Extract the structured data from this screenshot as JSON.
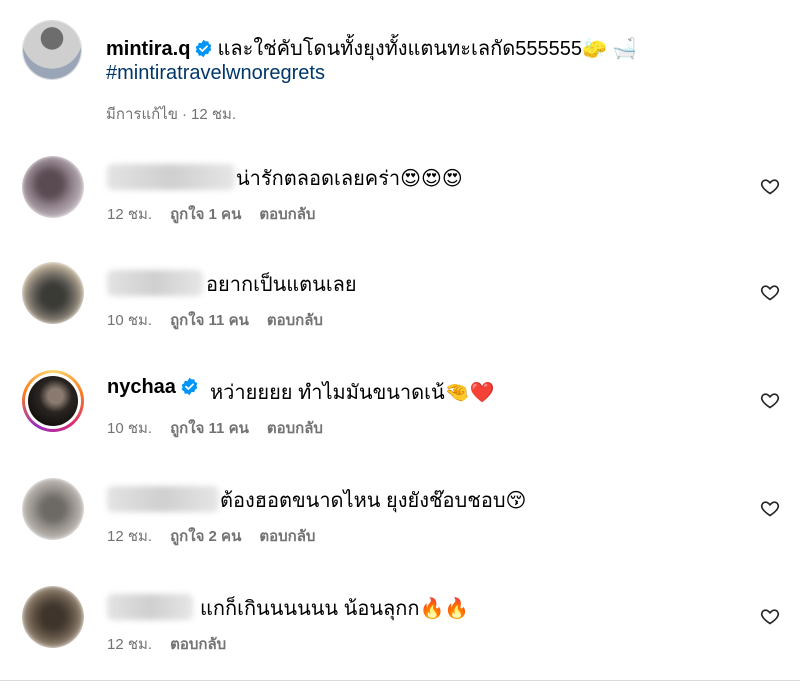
{
  "post": {
    "username": "mintira.q",
    "caption": "และใช่คับโดนทั้งยุงทั้งแตนทะเลกัด555555",
    "caption_emojis": "🧽 🛁",
    "hashtag": "#mintiratravelwnoregrets",
    "edited_label": "มีการแก้ไข",
    "separator": "·",
    "time": "12 ชม."
  },
  "comments": [
    {
      "text": "น่ารักตลอดเลยคร่า😍😍😍",
      "time": "12 ชม.",
      "likes": "ถูกใจ 1 คน",
      "reply": "ตอบกลับ"
    },
    {
      "text": "อยากเป็นแตนเลย",
      "time": "10 ชม.",
      "likes": "ถูกใจ 11 คน",
      "reply": "ตอบกลับ"
    },
    {
      "username": "nychaa",
      "text": "หว่ายยยย ทำไมมันขนาดเน้🤏❤️",
      "time": "10 ชม.",
      "likes": "ถูกใจ 11 คน",
      "reply": "ตอบกลับ"
    },
    {
      "text": "ต้องฮอตขนาดไหน ยุงยังช๊อบชอบ😚",
      "time": "12 ชม.",
      "likes": "ถูกใจ 2 คน",
      "reply": "ตอบกลับ"
    },
    {
      "text": "แกก็เกินนนนนน น้อนลุกก🔥🔥",
      "time": "12 ชม.",
      "reply": "ตอบกลับ"
    }
  ],
  "colors": {
    "verified": "#0095f6",
    "hashtag": "#00376b",
    "meta": "#737373",
    "story_ring_start": "#feda75",
    "story_ring_end": "#d62976"
  },
  "icons": {
    "verified": "verified-badge-icon",
    "like": "heart-outline-icon"
  }
}
